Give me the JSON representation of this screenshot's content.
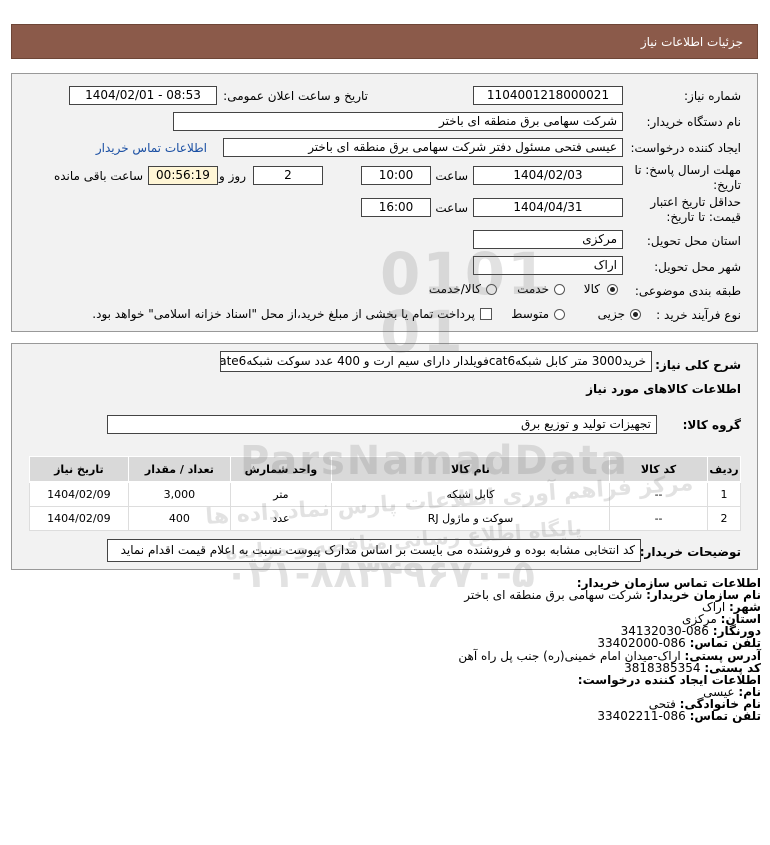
{
  "header": {
    "title": "جزئیات اطلاعات نیاز"
  },
  "form": {
    "need_number_label": "شماره نیاز:",
    "need_number": "1104001218000021",
    "announce_label": "تاریخ و ساعت اعلان عمومی:",
    "announce_value": "1404/02/01 - 08:53",
    "buyer_org_label": "نام دستگاه خریدار:",
    "buyer_org": "شرکت سهامی برق منطقه ای باختر",
    "requester_label": "ایجاد کننده درخواست:",
    "requester": "عیسی فتحی مسئول دفتر شرکت سهامی برق منطقه ای باختر",
    "buyer_contact_link": "اطلاعات تماس خریدار",
    "deadline_label_1": "مهلت ارسال پاسخ: تا",
    "deadline_label_2": "تاریخ:",
    "deadline_date": "1404/02/03",
    "time_label": "ساعت",
    "deadline_time": "10:00",
    "days": "2",
    "days_label": "روز و",
    "remaining_time": "00:56:19",
    "remaining_label": "ساعت باقی مانده",
    "validity_label_1": "حداقل تاریخ اعتبار",
    "validity_label_2": "قیمت: تا تاریخ:",
    "validity_date": "1404/04/31",
    "validity_time": "16:00",
    "province_label": "استان محل تحویل:",
    "province": "مرکزی",
    "city_label": "شهر محل تحویل:",
    "city": "اراک",
    "category_label": "طبقه بندی موضوعی:",
    "category_options": [
      "کالا",
      "خدمت",
      "کالا/خدمت"
    ],
    "process_label": "نوع فرآیند خرید :",
    "process_options": [
      "جزیی",
      "متوسط"
    ],
    "payment_note": "پرداخت تمام یا بخشی از مبلغ خرید،از محل \"اسناد خزانه اسلامی\" خواهد بود."
  },
  "summary": {
    "label": "شرح کلی نیاز:",
    "text": "خرید3000 متر کابل شبکهcat6فویلدار دارای سیم ارت و 400 عدد سوکت شبکهcate6"
  },
  "goods": {
    "section_title": "اطلاعات کالاهای مورد نیاز",
    "group_label": "گروه کالا:",
    "group_value": "تجهیزات تولید و توزیع برق",
    "columns": [
      "ردیف",
      "کد کالا",
      "نام کالا",
      "واحد شمارش",
      "تعداد / مقدار",
      "تاریخ نیاز"
    ],
    "rows": [
      [
        "1",
        "--",
        "کابل شبکه",
        "متر",
        "3,000",
        "1404/02/09"
      ],
      [
        "2",
        "--",
        "سوکت و ماژول RJ",
        "عدد",
        "400",
        "1404/02/09"
      ]
    ]
  },
  "notes": {
    "label": "توضیحات خریدار:",
    "text": "کد انتخابی مشابه بوده و فروشنده می بایست بر اساس مدارک پیوست نسبت به اعلام قیمت اقدام نماید"
  },
  "contact": {
    "lines": [
      {
        "label": "اطلاعات تماس سازمان خریدار:",
        "value": ""
      },
      {
        "label": "نام سازمان خریدار:",
        "value": " شرکت سهامی برق منطقه ای باختر"
      },
      {
        "label": "شهر:",
        "value": " اراک"
      },
      {
        "label": "استان:",
        "value": " مرکزی"
      },
      {
        "label": "دورنگار:",
        "value": " 086-34132030"
      },
      {
        "label": "تلفن تماس:",
        "value": " 086-33402000"
      },
      {
        "label": "آدرس پستی:",
        "value": " اراک-میدان امام خمینی(ره) جنب پل راه آهن"
      },
      {
        "label": "کد پستی:",
        "value": " 3818385354"
      },
      {
        "label": "اطلاعات ایجاد کننده درخواست:",
        "value": ""
      },
      {
        "label": "نام:",
        "value": " عیسی"
      },
      {
        "label": "نام خانوادگی:",
        "value": " فتحی"
      },
      {
        "label": "تلفن تماس:",
        "value": " 086-33402211"
      }
    ]
  },
  "watermark": {
    "brand": "ParsNamadData",
    "phone": "۰۲۱-۸۸۳۴۹۶۷۰-۵",
    "digits": "010101",
    "line1": "مرکز فراهم آوری اطلاعات پارس نماد داده ها",
    "line2": "پایگاه اطلاع رسانی مناقصه و مزایده"
  }
}
